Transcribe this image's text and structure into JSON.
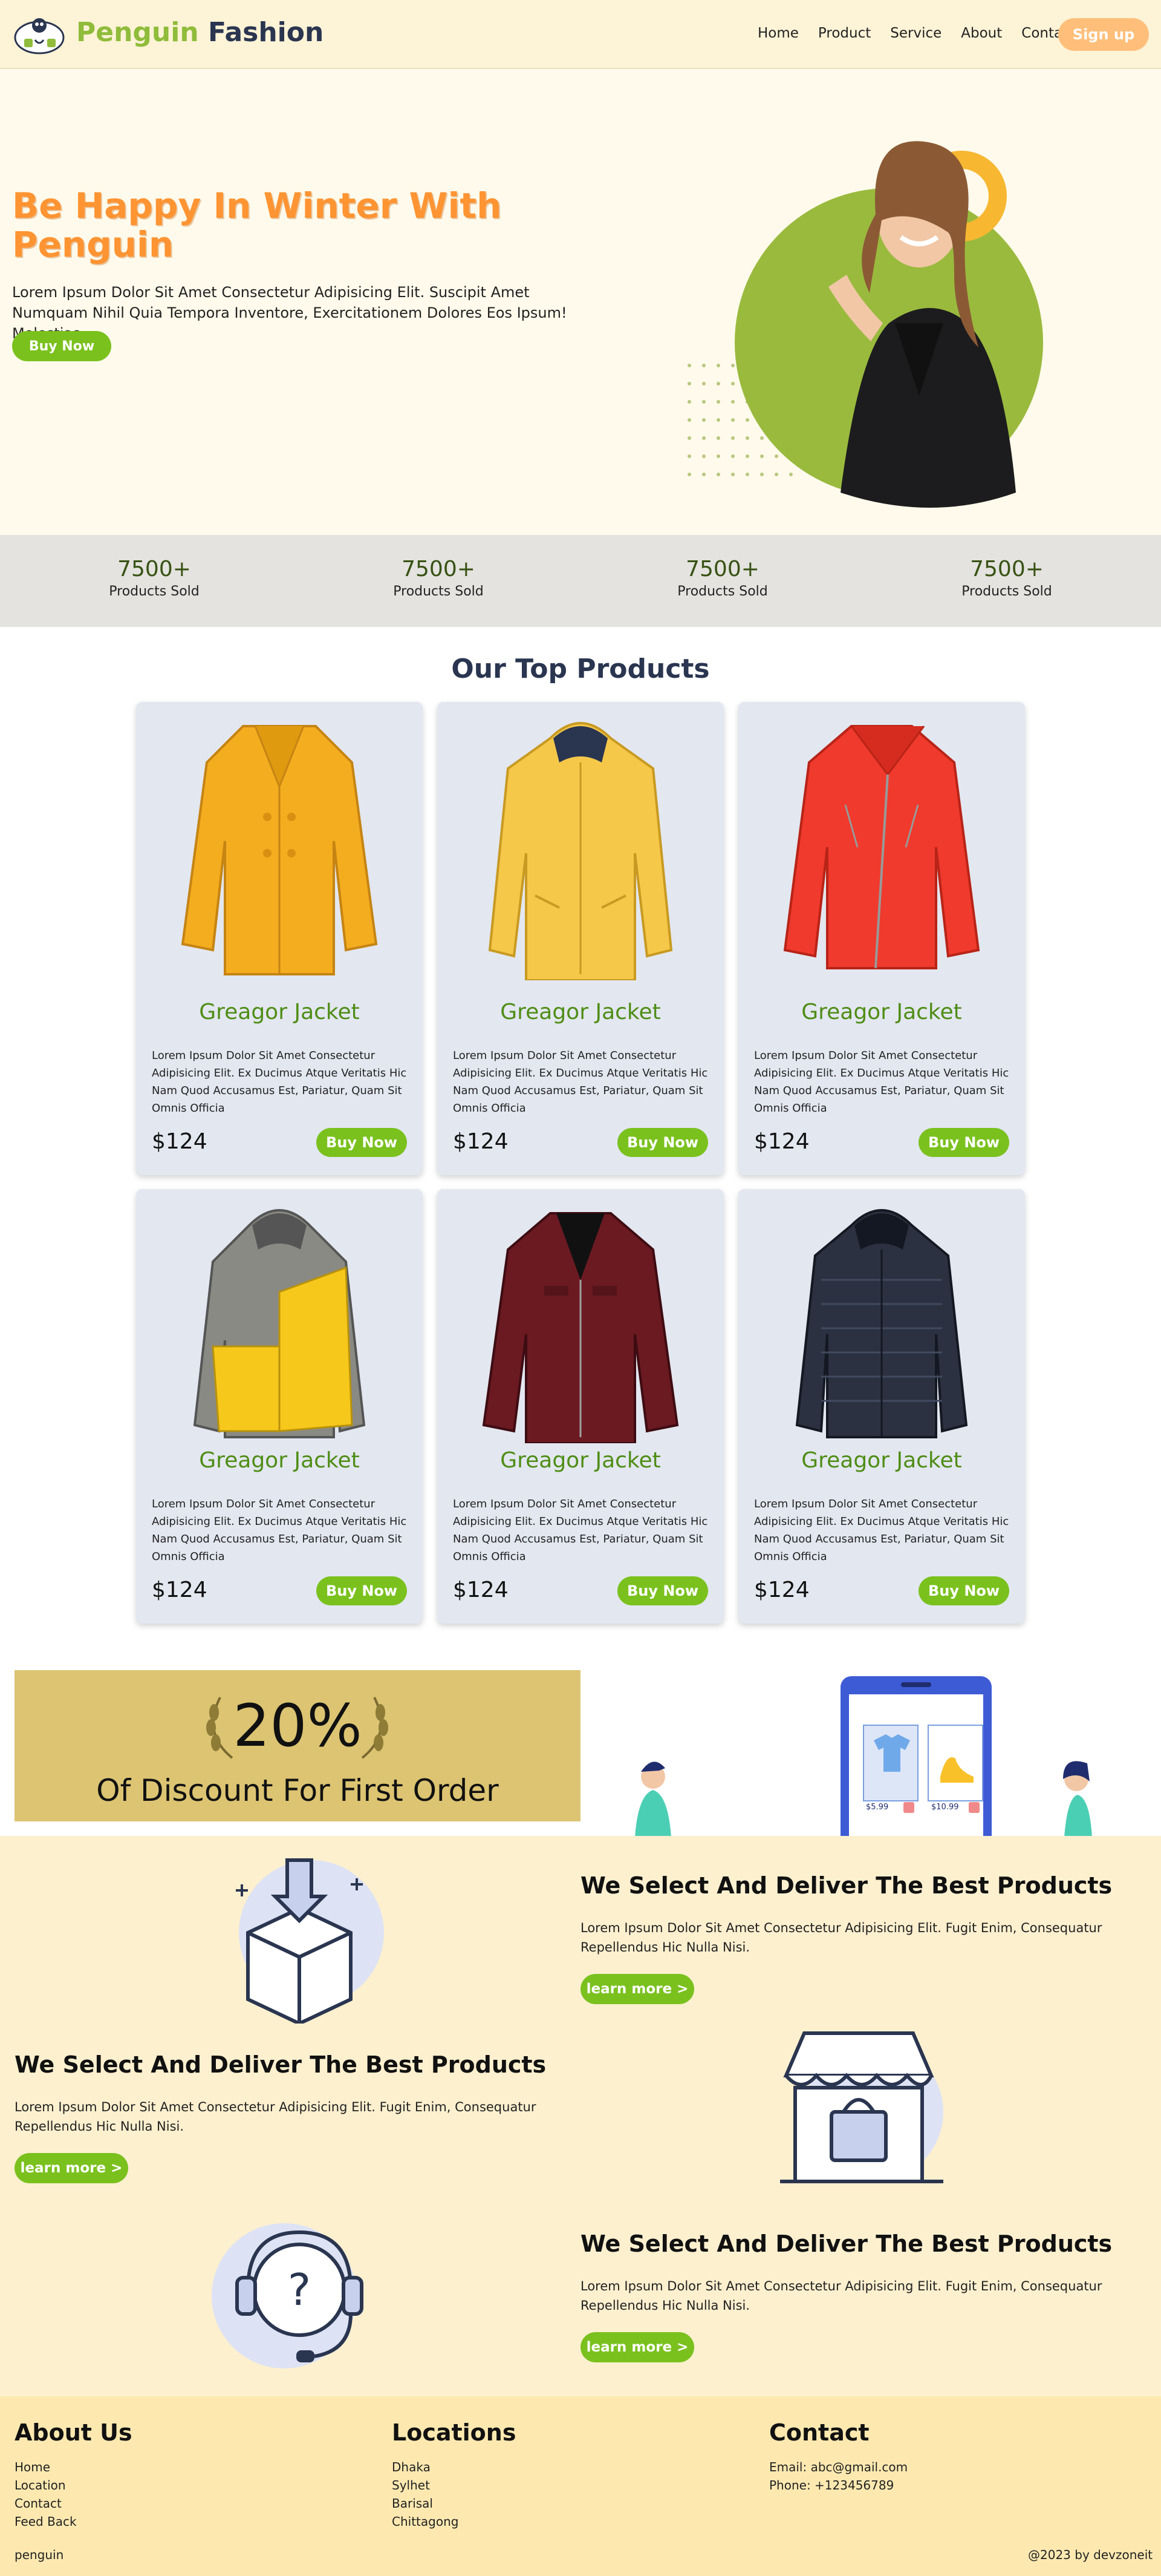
{
  "brand": {
    "name_part1": "Penguin",
    "name_part2": "Fashion"
  },
  "nav": {
    "links": [
      "Home",
      "Product",
      "Service",
      "About",
      "Contact"
    ],
    "signup_label": "Sign up"
  },
  "colors": {
    "accent_green": "#7ac11e",
    "accent_orange": "#ff9433",
    "navy": "#2a3550",
    "cream": "#fdf3d6"
  },
  "hero": {
    "title": "Be Happy In Winter With Penguin",
    "text": "Lorem Ipsum Dolor Sit Amet Consectetur Adipisicing Elit. Suscipit Amet Numquam Nihil Quia Tempora Inventore, Exercitationem Dolores Eos Ipsum! Molestias",
    "button_label": "Buy Now"
  },
  "stats": [
    {
      "value": "7500+",
      "label": "Products Sold"
    },
    {
      "value": "7500+",
      "label": "Products Sold"
    },
    {
      "value": "7500+",
      "label": "Products Sold"
    },
    {
      "value": "7500+",
      "label": "Products Sold"
    }
  ],
  "products_section": {
    "title": "Our Top Products"
  },
  "products": [
    {
      "name": "Greagor Jacket",
      "desc": "Lorem Ipsum Dolor Sit Amet Consectetur Adipisicing Elit. Ex Ducimus Atque Veritatis Hic Nam Quod Accusamus Est, Pariatur, Quam Sit Omnis Officia",
      "price": "$124",
      "button_label": "Buy Now",
      "jacket_icon": "yellow-coat"
    },
    {
      "name": "Greagor Jacket",
      "desc": "Lorem Ipsum Dolor Sit Amet Consectetur Adipisicing Elit. Ex Ducimus Atque Veritatis Hic Nam Quod Accusamus Est, Pariatur, Quam Sit Omnis Officia",
      "price": "$124",
      "button_label": "Buy Now",
      "jacket_icon": "yellow-parka"
    },
    {
      "name": "Greagor Jacket",
      "desc": "Lorem Ipsum Dolor Sit Amet Consectetur Adipisicing Elit. Ex Ducimus Atque Veritatis Hic Nam Quod Accusamus Est, Pariatur, Quam Sit Omnis Officia",
      "price": "$124",
      "button_label": "Buy Now",
      "jacket_icon": "red-biker-jacket"
    },
    {
      "name": "Greagor Jacket",
      "desc": "Lorem Ipsum Dolor Sit Amet Consectetur Adipisicing Elit. Ex Ducimus Atque Veritatis Hic Nam Quod Accusamus Est, Pariatur, Quam Sit Omnis Officia",
      "price": "$124",
      "button_label": "Buy Now",
      "jacket_icon": "yellow-grey-puffer"
    },
    {
      "name": "Greagor Jacket",
      "desc": "Lorem Ipsum Dolor Sit Amet Consectetur Adipisicing Elit. Ex Ducimus Atque Veritatis Hic Nam Quod Accusamus Est, Pariatur, Quam Sit Omnis Officia",
      "price": "$124",
      "button_label": "Buy Now",
      "jacket_icon": "maroon-leather-jacket"
    },
    {
      "name": "Greagor Jacket",
      "desc": "Lorem Ipsum Dolor Sit Amet Consectetur Adipisicing Elit. Ex Ducimus Atque Veritatis Hic Nam Quod Accusamus Est, Pariatur, Quam Sit Omnis Officia",
      "price": "$124",
      "button_label": "Buy Now",
      "jacket_icon": "navy-puffer"
    }
  ],
  "discount": {
    "percent": "20%",
    "text": "Of Discount For First Order",
    "illustration_prices": [
      "$5.99",
      "$10.99"
    ]
  },
  "features": [
    {
      "title": "We Select And Deliver The Best Products",
      "text": "Lorem Ipsum Dolor Sit Amet Consectetur Adipisicing Elit. Fugit Enim, Consequatur Repellendus Hic Nulla Nisi.",
      "button_label": "learn more >",
      "icon": "box-download-icon"
    },
    {
      "title": "We Select And Deliver The Best Products",
      "text": "Lorem Ipsum Dolor Sit Amet Consectetur Adipisicing Elit. Fugit Enim, Consequatur Repellendus Hic Nulla Nisi.",
      "button_label": "learn more >",
      "icon": "shop-store-icon"
    },
    {
      "title": "We Select And Deliver The Best Products",
      "text": "Lorem Ipsum Dolor Sit Amet Consectetur Adipisicing Elit. Fugit Enim, Consequatur Repellendus Hic Nulla Nisi.",
      "button_label": "learn more >",
      "icon": "support-headset-icon"
    }
  ],
  "footer": {
    "about": {
      "title": "About Us",
      "links": [
        "Home",
        "Location",
        "Contact",
        "Feed Back"
      ]
    },
    "locations": {
      "title": "Locations",
      "items": [
        "Dhaka",
        "Sylhet",
        "Barisal",
        "Chittagong"
      ]
    },
    "contact": {
      "title": "Contact",
      "items": [
        "Email: abc@gmail.com",
        "Phone: +123456789"
      ]
    },
    "brand_small": "penguin",
    "copyright": "@2023 by devzoneit"
  }
}
